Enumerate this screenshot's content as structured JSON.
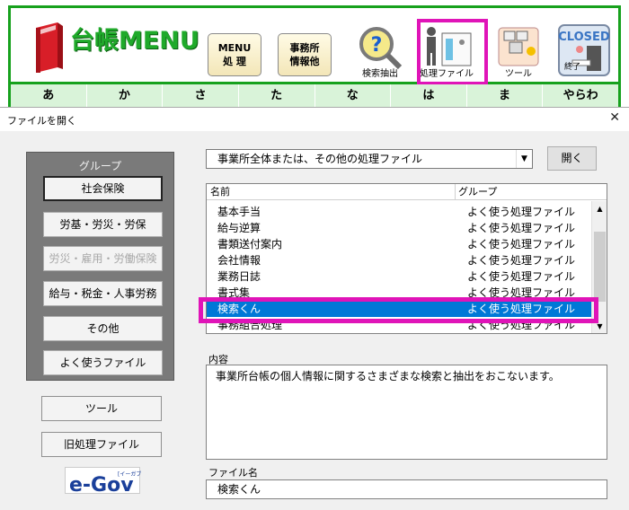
{
  "app": {
    "logo_text": "台帳MENU",
    "toolbar": {
      "menu_btn": "MENU\n処 理",
      "office_btn": "事務所\n情報他",
      "search_extract": "検索抽出",
      "process_file": "処理ファイル",
      "tool": "ツール",
      "closed": "CLOSED",
      "end": "終了"
    },
    "kana_tabs": [
      "あ",
      "か",
      "さ",
      "た",
      "な",
      "は",
      "ま",
      "やらわ"
    ]
  },
  "dialog": {
    "title": "ファイルを開く",
    "close_glyph": "✕",
    "group_label": "グループ",
    "groups": [
      {
        "label": "社会保険",
        "state": "selected"
      },
      {
        "label": "労基・労災・労保",
        "state": "normal"
      },
      {
        "label": "労災・雇用・労働保険",
        "state": "disabled"
      },
      {
        "label": "給与・税金・人事労務",
        "state": "normal"
      },
      {
        "label": "その他",
        "state": "normal"
      },
      {
        "label": "よく使うファイル",
        "state": "normal"
      }
    ],
    "tool_button": "ツール",
    "old_file_button": "旧処理ファイル",
    "egov_logo": "e-Gov",
    "egov_ruby": "[イーガブ]",
    "combo_value": "事業所全体または、その他の処理ファイル",
    "open_button": "開く",
    "list_headers": {
      "name": "名前",
      "group": "グループ"
    },
    "rows": [
      {
        "name": "基本手当",
        "group": "よく使う処理ファイル",
        "selected": false
      },
      {
        "name": "給与逆算",
        "group": "よく使う処理ファイル",
        "selected": false
      },
      {
        "name": "書類送付案内",
        "group": "よく使う処理ファイル",
        "selected": false
      },
      {
        "name": "会社情報",
        "group": "よく使う処理ファイル",
        "selected": false
      },
      {
        "name": "業務日誌",
        "group": "よく使う処理ファイル",
        "selected": false
      },
      {
        "name": "書式集",
        "group": "よく使う処理ファイル",
        "selected": false
      },
      {
        "name": "検索くん",
        "group": "よく使う処理ファイル",
        "selected": true
      },
      {
        "name": "事務組合処理",
        "group": "よく使う処理ファイル",
        "selected": false
      }
    ],
    "content_label": "内容",
    "content_text": "事業所台帳の個人情報に関するさまざまな検索と抽出をおこないます。",
    "filename_label": "ファイル名",
    "filename_value": "検索くん"
  },
  "colors": {
    "accent_green": "#17a11d",
    "selection_blue": "#0078d7",
    "highlight_magenta": "#e014b8"
  }
}
